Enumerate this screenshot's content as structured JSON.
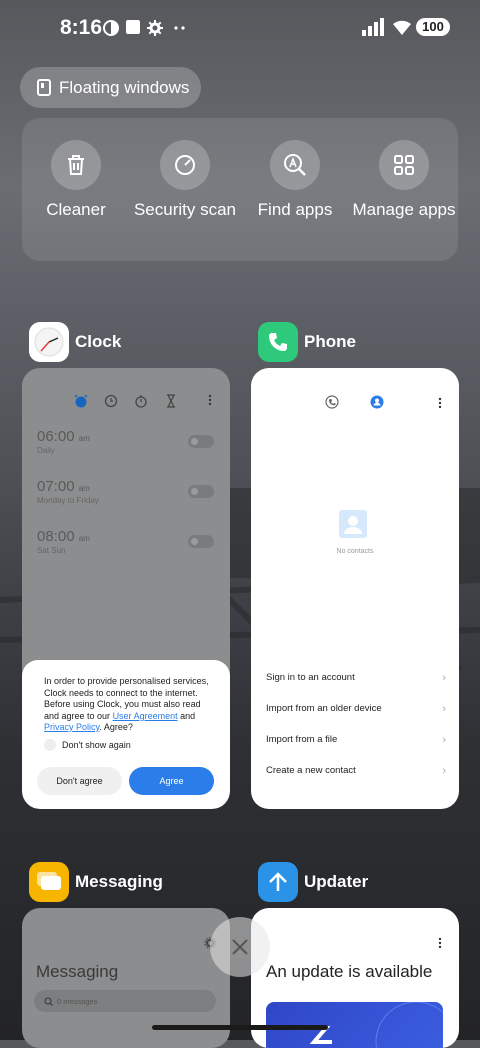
{
  "status_bar": {
    "time": "8:16",
    "battery": "100"
  },
  "floating_windows": {
    "label": "Floating windows"
  },
  "quick_actions": [
    {
      "label": "Cleaner",
      "icon": "trash-icon"
    },
    {
      "label": "Security scan",
      "icon": "gauge-icon"
    },
    {
      "label": "Find apps",
      "icon": "search-app-icon"
    },
    {
      "label": "Manage apps",
      "icon": "grid-icon"
    }
  ],
  "clock": {
    "app_name": "Clock",
    "alarms": [
      {
        "time": "06:00",
        "ampm": "am",
        "repeat": "Daily"
      },
      {
        "time": "07:00",
        "ampm": "am",
        "repeat": "Monday to Friday"
      },
      {
        "time": "08:00",
        "ampm": "am",
        "repeat": "Sat Sun"
      }
    ],
    "dialog": {
      "message_start": "In order to provide personalised services, Clock needs to connect to the internet. Before using Clock, you must also read and agree to our ",
      "link_user_agreement": "User Agreement",
      "and": " and ",
      "link_privacy": "Privacy Policy",
      "message_end": ". Agree?",
      "checkbox_label": "Don't show again",
      "disagree": "Don't agree",
      "agree": "Agree"
    }
  },
  "phone": {
    "app_name": "Phone",
    "empty_text": "No contacts",
    "options": [
      "Sign in to an account",
      "Import from an older device",
      "Import from a file",
      "Create a new contact"
    ]
  },
  "messaging": {
    "app_name": "Messaging",
    "title": "Messaging",
    "search_placeholder": "0 messages"
  },
  "updater": {
    "app_name": "Updater",
    "title": "An update is available"
  },
  "colors": {
    "accent": "#2b7de9",
    "phone_green": "#2fc97b",
    "messaging_yellow": "#f7b500",
    "updater_blue": "#2a93e8"
  }
}
